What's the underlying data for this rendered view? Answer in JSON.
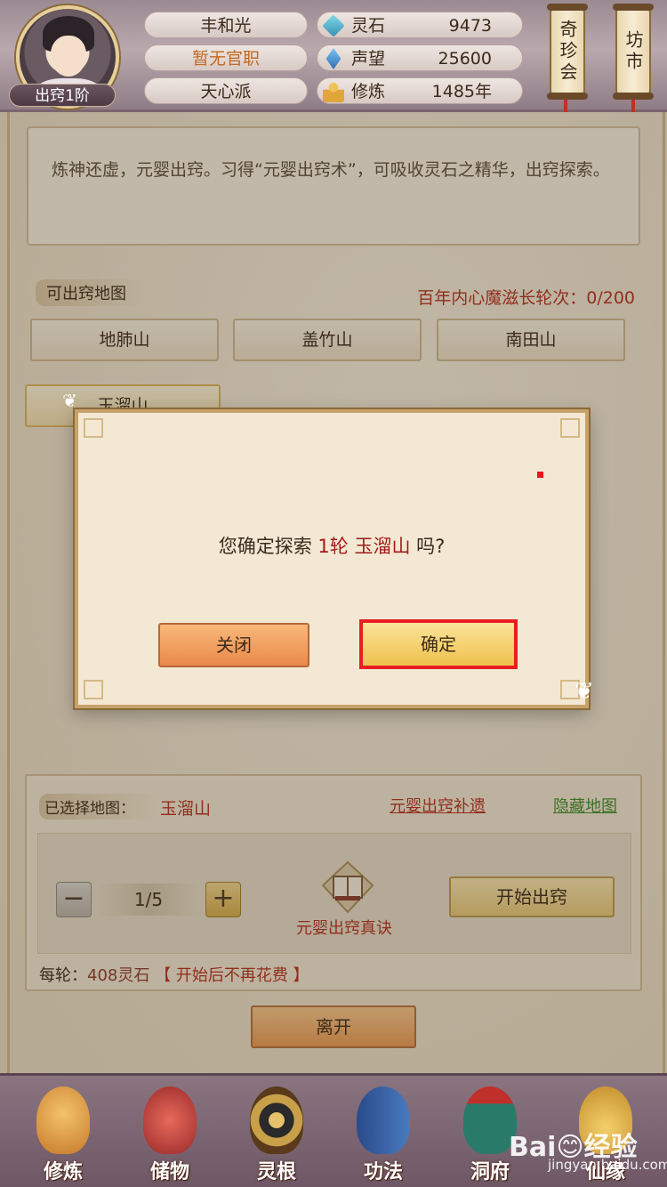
{
  "player": {
    "rank_label": "出窍1阶",
    "name": "丰和光",
    "official_title": "暂无官职",
    "sect": "天心派"
  },
  "resources": [
    {
      "icon": "spirit-stone-icon",
      "label": "灵石",
      "value": "9473"
    },
    {
      "icon": "reputation-icon",
      "label": "声望",
      "value": "25600"
    },
    {
      "icon": "meditation-icon",
      "label": "修炼",
      "value": "1485年"
    }
  ],
  "top_buttons": {
    "treasure_fair": "奇珍会",
    "market": "坊市"
  },
  "description": "炼神还虚，元婴出窍。习得“元婴出窍术”，可吸收灵石之精华，出窍探索。",
  "maps": {
    "section_label": "可出窍地图",
    "demon_counter": "百年内心魔滋长轮次：0/200",
    "items": [
      "地肺山",
      "盖竹山",
      "南田山",
      "玉溜山"
    ]
  },
  "dialog": {
    "msg_prefix": "您确定探索",
    "msg_rounds": "1轮",
    "msg_map": "玉溜山",
    "msg_suffix": "吗?",
    "close_label": "关闭",
    "confirm_label": "确定"
  },
  "selection": {
    "label": "已选择地图：",
    "value": "玉溜山",
    "link_supplement": "元婴出窍补遗",
    "link_hide": "隐藏地图",
    "stepper_value": "1/5",
    "book_label": "元婴出窍真诀",
    "start_label": "开始出窍",
    "cost_prefix": "每轮：",
    "cost_value": "408灵石",
    "cost_note": "【 开始后不再花费 】"
  },
  "leave_label": "离开",
  "bottom_nav": [
    "修炼",
    "储物",
    "灵根",
    "功法",
    "洞府",
    "仙缘"
  ],
  "watermark": {
    "main": "Bai😊经验",
    "sub": "jingyan.baidu.com"
  },
  "colors": {
    "accent_red": "#b2301f",
    "highlight_red": "#a5191c",
    "link_green": "#3d8a2a",
    "confirm_outline": "#e81e22"
  }
}
